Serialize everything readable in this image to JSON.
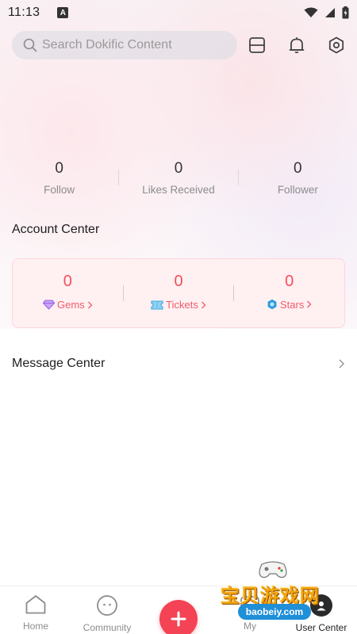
{
  "status_bar": {
    "time": "11:13",
    "notification_badge": "A"
  },
  "search": {
    "placeholder": "Search Dokific Content"
  },
  "top_icons": [
    "scan-icon",
    "bell-icon",
    "settings-icon"
  ],
  "stats": [
    {
      "value": "0",
      "label": "Follow"
    },
    {
      "value": "0",
      "label": "Likes Received"
    },
    {
      "value": "0",
      "label": "Follower"
    }
  ],
  "account_center": {
    "title": "Account Center",
    "items": [
      {
        "value": "0",
        "label": "Gems",
        "icon": "gem-icon"
      },
      {
        "value": "0",
        "label": "Tickets",
        "icon": "ticket-icon"
      },
      {
        "value": "0",
        "label": "Stars",
        "icon": "star-icon"
      }
    ]
  },
  "message_center": {
    "label": "Message Center"
  },
  "bottom_nav": [
    {
      "label": "Home",
      "icon": "home-icon"
    },
    {
      "label": "Community",
      "icon": "community-icon"
    },
    {
      "label": "",
      "icon": "plus-icon"
    },
    {
      "label": "My",
      "icon": "my-icon"
    },
    {
      "label": "User Center",
      "icon": "avatar-icon"
    }
  ],
  "watermark": {
    "text": "宝贝游戏网",
    "url": "baobeiy.com"
  },
  "colors": {
    "accent": "#f34354",
    "wallet_text": "#f24e5c",
    "gem": "#a974f0",
    "ticket": "#3fa9e0",
    "star": "#2a9be0"
  }
}
